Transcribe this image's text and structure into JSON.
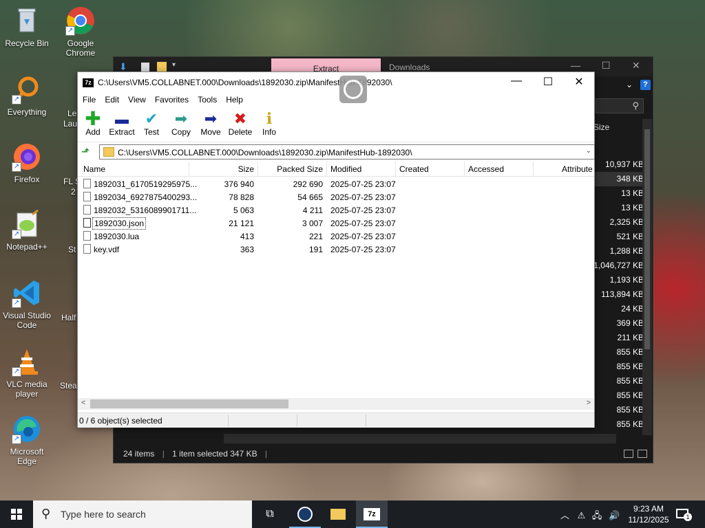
{
  "desktop": {
    "icons": [
      {
        "label": "Recycle Bin"
      },
      {
        "label": "Google Chrome"
      },
      {
        "label": "Everything"
      },
      {
        "label": "Firefox"
      },
      {
        "label": "Notepad++"
      },
      {
        "label": "Visual Studio Code"
      },
      {
        "label": "VLC media player"
      },
      {
        "label": "Microsoft Edge"
      }
    ],
    "partial_labels": [
      "Le",
      "Lau",
      "FL S",
      "2",
      "St",
      "Half",
      "Stea"
    ]
  },
  "explorer": {
    "ribbon_tab": "Extract",
    "title": "Downloads",
    "size_header": "Size",
    "sizes": [
      "10,937 KB",
      "348 KB",
      "13 KB",
      "13 KB",
      "2,325 KB",
      "521 KB",
      "1,288 KB",
      "1,046,727 KB",
      "1,193 KB",
      "113,894 KB",
      "24 KB",
      "369 KB",
      "211 KB",
      "855 KB",
      "855 KB",
      "855 KB",
      "855 KB",
      "855 KB",
      "855 KB"
    ],
    "status": {
      "items": "24 items",
      "selected": "1 item selected  347 KB"
    }
  },
  "zip": {
    "title": "C:\\Users\\VM5.COLLABNET.000\\Downloads\\1892030.zip\\ManifestHub-1892030\\",
    "menu": [
      "File",
      "Edit",
      "View",
      "Favorites",
      "Tools",
      "Help"
    ],
    "toolbar": {
      "add": "Add",
      "extract": "Extract",
      "test": "Test",
      "copy": "Copy",
      "move": "Move",
      "delete": "Delete",
      "info": "Info"
    },
    "address": "C:\\Users\\VM5.COLLABNET.000\\Downloads\\1892030.zip\\ManifestHub-1892030\\",
    "columns": {
      "name": "Name",
      "size": "Size",
      "packed": "Packed Size",
      "modified": "Modified",
      "created": "Created",
      "accessed": "Accessed",
      "attributes": "Attribute"
    },
    "files": [
      {
        "name": "1892031_6170519295975...",
        "size": "376 940",
        "packed": "292 690",
        "modified": "2025-07-25 23:07"
      },
      {
        "name": "1892034_6927875400293...",
        "size": "78 828",
        "packed": "54 665",
        "modified": "2025-07-25 23:07"
      },
      {
        "name": "1892032_5316089901711...",
        "size": "5 063",
        "packed": "4 211",
        "modified": "2025-07-25 23:07"
      },
      {
        "name": "1892030.json",
        "size": "21 121",
        "packed": "3 007",
        "modified": "2025-07-25 23:07"
      },
      {
        "name": "1892030.lua",
        "size": "413",
        "packed": "221",
        "modified": "2025-07-25 23:07"
      },
      {
        "name": "key.vdf",
        "size": "363",
        "packed": "191",
        "modified": "2025-07-25 23:07"
      }
    ],
    "status": "0 / 6 object(s) selected"
  },
  "taskbar": {
    "search_placeholder": "Type here to search",
    "time": "9:23 AM",
    "date": "11/12/2025",
    "notifications": "1"
  }
}
